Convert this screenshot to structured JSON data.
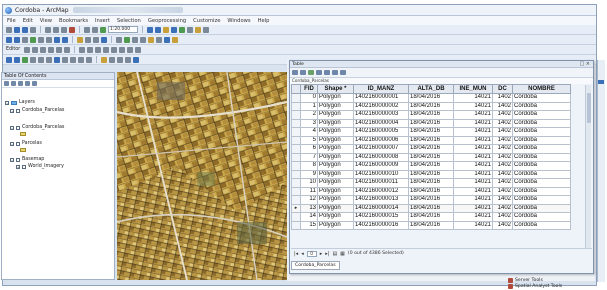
{
  "window": {
    "title": "Cordoba - ArcMap"
  },
  "menu": [
    "File",
    "Edit",
    "View",
    "Bookmarks",
    "Insert",
    "Selection",
    "Geoprocessing",
    "Customize",
    "Windows",
    "Help"
  ],
  "toolbar": {
    "scale": "1:20.000",
    "editor_label": "Editor"
  },
  "toc": {
    "header": "Table Of Contents",
    "items": [
      {
        "label": "Layers",
        "level": 0
      },
      {
        "label": "Cordoba_Parcelas",
        "level": 1
      },
      {
        "label": "Cordoba_Parcelas",
        "level": 1
      },
      {
        "label": "Parcelas",
        "level": 1
      },
      {
        "label": "Basemap",
        "level": 1
      },
      {
        "label": "World_Imagery",
        "level": 2
      }
    ]
  },
  "table": {
    "window_title": "Table",
    "subtitle": "Cordoba_Parcelas",
    "columns": [
      "FID",
      "Shape *",
      "ID_MANZ",
      "ALTA_DB",
      "INE_MUN",
      "DC",
      "NOMBRE"
    ],
    "rows": [
      [
        "0",
        "Polygon",
        "1402160000001",
        "18/04/2016",
        "14021",
        "1402",
        "Córdoba"
      ],
      [
        "1",
        "Polygon",
        "1402160000002",
        "18/04/2016",
        "14021",
        "1402",
        "Córdoba"
      ],
      [
        "2",
        "Polygon",
        "1402160000003",
        "18/04/2016",
        "14021",
        "1402",
        "Córdoba"
      ],
      [
        "3",
        "Polygon",
        "1402160000004",
        "18/04/2016",
        "14021",
        "1402",
        "Córdoba"
      ],
      [
        "4",
        "Polygon",
        "1402160000005",
        "18/04/2016",
        "14021",
        "1402",
        "Córdoba"
      ],
      [
        "5",
        "Polygon",
        "1402160000006",
        "18/04/2016",
        "14021",
        "1402",
        "Córdoba"
      ],
      [
        "6",
        "Polygon",
        "1402160000007",
        "18/04/2016",
        "14021",
        "1402",
        "Córdoba"
      ],
      [
        "7",
        "Polygon",
        "1402160000008",
        "18/04/2016",
        "14021",
        "1402",
        "Córdoba"
      ],
      [
        "8",
        "Polygon",
        "1402160000009",
        "18/04/2016",
        "14021",
        "1402",
        "Córdoba"
      ],
      [
        "9",
        "Polygon",
        "1402160000010",
        "18/04/2016",
        "14021",
        "1402",
        "Córdoba"
      ],
      [
        "10",
        "Polygon",
        "1402160000011",
        "18/04/2016",
        "14021",
        "1402",
        "Córdoba"
      ],
      [
        "11",
        "Polygon",
        "1402160000012",
        "18/04/2016",
        "14021",
        "1402",
        "Córdoba"
      ],
      [
        "12",
        "Polygon",
        "1402160000013",
        "18/04/2016",
        "14021",
        "1402",
        "Córdoba"
      ],
      [
        "13",
        "Polygon",
        "1402160000014",
        "18/04/2016",
        "14021",
        "1402",
        "Córdoba"
      ],
      [
        "14",
        "Polygon",
        "1402160000015",
        "18/04/2016",
        "14021",
        "1402",
        "Córdoba"
      ],
      [
        "15",
        "Polygon",
        "1402160000016",
        "18/04/2016",
        "14021",
        "1402",
        "Córdoba"
      ]
    ],
    "active_row_index": 13,
    "footer": {
      "page": "0",
      "status": "(0 out of 4386 Selected)"
    },
    "tab_label": "Cordoba_Parcelas"
  },
  "side": {
    "bottom_items": [
      "Server Tools",
      "Spatial Analyst Tools"
    ]
  }
}
